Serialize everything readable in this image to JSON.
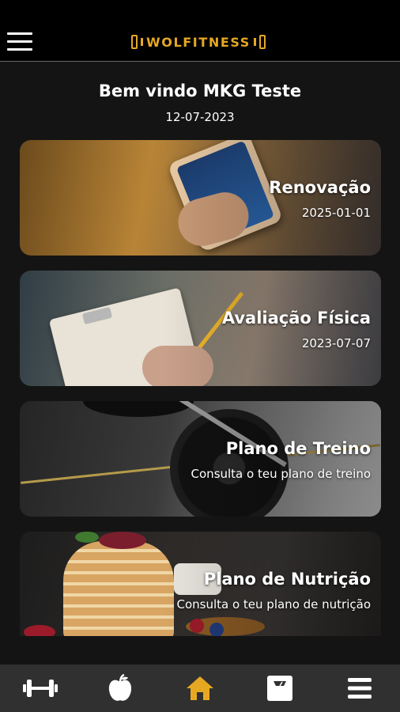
{
  "header": {
    "brand": "WOLFITNESS",
    "brand_color": "#e6a823",
    "menu_icon": "hamburger-icon"
  },
  "welcome": {
    "greeting": "Bem vindo MKG Teste",
    "date": "12-07-2023"
  },
  "cards": [
    {
      "title": "Renovação",
      "subtitle": "2025-01-01",
      "image": "phone-app-photo"
    },
    {
      "title": "Avaliação Física",
      "subtitle": "2023-07-07",
      "image": "clipboard-writing-photo"
    },
    {
      "title": "Plano de Treino",
      "subtitle": "Consulta o teu plano de treino",
      "image": "barbell-weight-photo"
    },
    {
      "title": "Plano de Nutrição",
      "subtitle": "Consulta o teu plano de nutrição",
      "image": "pancakes-photo"
    }
  ],
  "bottom_nav": {
    "items": [
      {
        "icon": "dumbbell-icon"
      },
      {
        "icon": "apple-icon"
      },
      {
        "icon": "home-icon",
        "active": true
      },
      {
        "icon": "scale-icon"
      },
      {
        "icon": "menu-icon"
      }
    ],
    "active_color": "#e6a823",
    "inactive_color": "#ffffff"
  }
}
